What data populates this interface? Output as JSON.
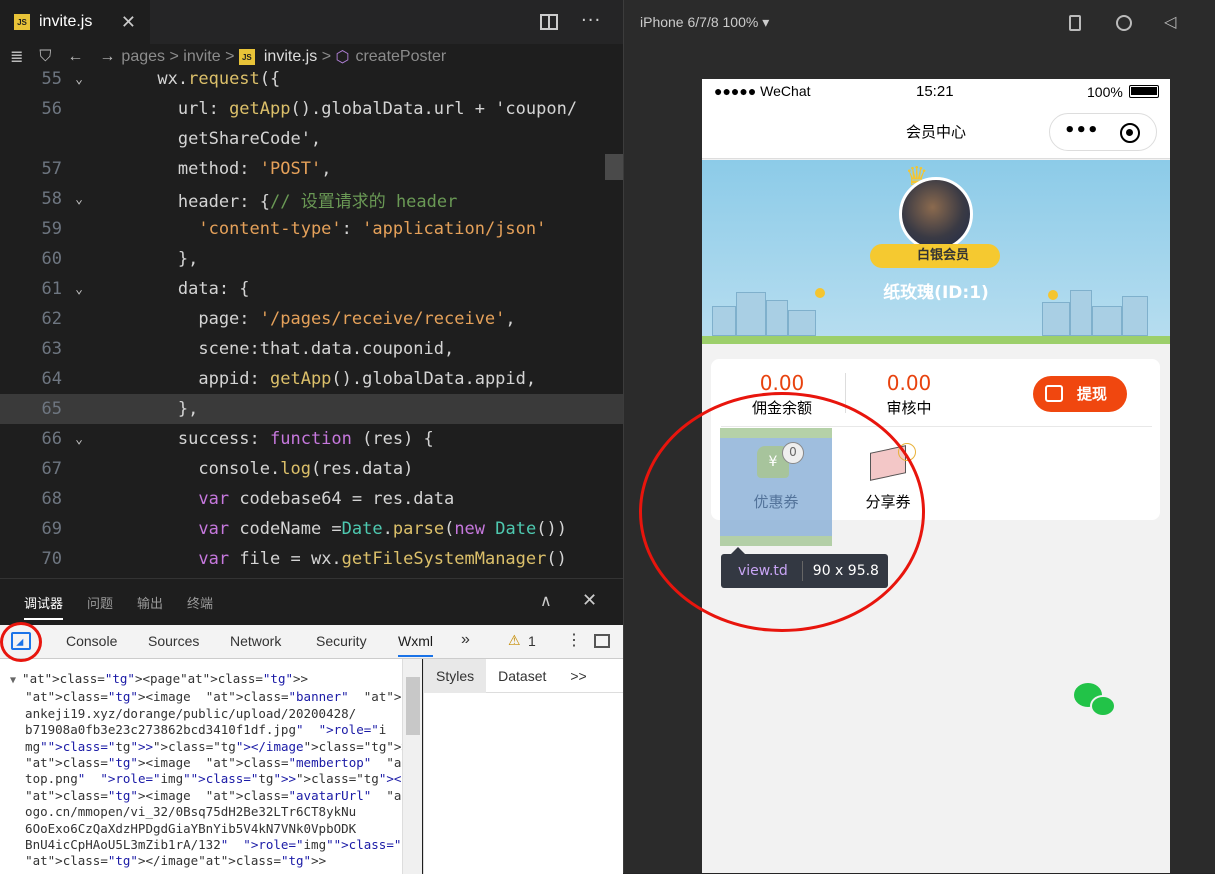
{
  "editor": {
    "tab_label": "invite.js",
    "tab_close": "✕",
    "more": "···",
    "breadcrumb": {
      "p1": "pages",
      "p2": "invite",
      "file": "invite.js",
      "symbol": "createPoster",
      "sep": ">"
    },
    "lines": [
      {
        "n": "55",
        "fold": "⌄",
        "hl": false,
        "t": "      wx.request({"
      },
      {
        "n": "56",
        "fold": "",
        "hl": false,
        "t": "        url: getApp().globalData.url + 'coupon/"
      },
      {
        "n": "",
        "fold": "",
        "hl": false,
        "t": "        getShareCode',"
      },
      {
        "n": "57",
        "fold": "",
        "hl": false,
        "t": "        method: 'POST',"
      },
      {
        "n": "58",
        "fold": "⌄",
        "hl": false,
        "t": "        header: {// 设置请求的 header"
      },
      {
        "n": "59",
        "fold": "",
        "hl": false,
        "t": "          'content-type': 'application/json'"
      },
      {
        "n": "60",
        "fold": "",
        "hl": false,
        "t": "        },"
      },
      {
        "n": "61",
        "fold": "⌄",
        "hl": false,
        "t": "        data: {"
      },
      {
        "n": "62",
        "fold": "",
        "hl": false,
        "t": "          page: '/pages/receive/receive',"
      },
      {
        "n": "63",
        "fold": "",
        "hl": false,
        "t": "          scene:that.data.couponid,"
      },
      {
        "n": "64",
        "fold": "",
        "hl": false,
        "t": "          appid: getApp().globalData.appid,"
      },
      {
        "n": "65",
        "fold": "",
        "hl": true,
        "t": "        },"
      },
      {
        "n": "66",
        "fold": "⌄",
        "hl": false,
        "t": "        success: function (res) {"
      },
      {
        "n": "67",
        "fold": "",
        "hl": false,
        "t": "          console.log(res.data)"
      },
      {
        "n": "68",
        "fold": "",
        "hl": false,
        "t": "          var codebase64 = res.data"
      },
      {
        "n": "69",
        "fold": "",
        "hl": false,
        "t": "          var codeName =Date.parse(new Date())"
      },
      {
        "n": "70",
        "fold": "",
        "hl": false,
        "t": "          var file = wx.getFileSystemManager()"
      }
    ]
  },
  "panel": {
    "tabs": [
      "调试器",
      "问题",
      "输出",
      "终端"
    ],
    "collapse": "∧",
    "close": "✕",
    "devtools_tabs": [
      "Console",
      "Sources",
      "Network",
      "Security",
      "Wxml"
    ],
    "more_tabs": "»",
    "warn_icon": "⚠",
    "warn_count": "1",
    "menu": "⋮",
    "elements": [
      "<page>",
      "  <image  class=\"banner\"  src=\"https://www.wanf",
      "  ankeji19.xyz/dorange/public/upload/20200428/",
      "  b71908a0fb3e23c273862bcd3410f1df.jpg\"  role=\"i",
      "  mg\"></image>",
      "  <image  class=\"membertop\"  src=\"/imgs/member",
      "  top.png\"  role=\"img\"></image>",
      "  <image  class=\"avatarUrl\"  src=\"https://wx.ql",
      "  ogo.cn/mmopen/vi_32/0Bsq75dH2Be32LTr6CT8ykNu",
      "  6OoExo6CzQaXdzHPDgdGiaYBnYib5V4kN7VNk0VpbODK",
      "  BnU4icCpHAoU5L3mZib1rA/132\"  role=\"img\">",
      "  </image>"
    ],
    "side_tabs": [
      "Styles",
      "Dataset",
      ">>"
    ]
  },
  "simulator": {
    "device": "iPhone 6/7/8 100% ▾",
    "status": {
      "carrier": "●●●●● WeChat",
      "time": "15:21",
      "battery": "100%"
    },
    "nav_title": "会员中心",
    "capsule_more": "•••",
    "badge": "白银会员",
    "username": "纸玫瑰(ID:1)",
    "commission_value": "0.00",
    "commission_label": "佣金余额",
    "review_value": "0.00",
    "review_label": "审核中",
    "withdraw": "提现",
    "icon1_label": "优惠券",
    "icon1_count": "0",
    "icon2_label": "分享券",
    "tooltip_tag": "view.td",
    "tooltip_size": "90 x 95.8"
  }
}
